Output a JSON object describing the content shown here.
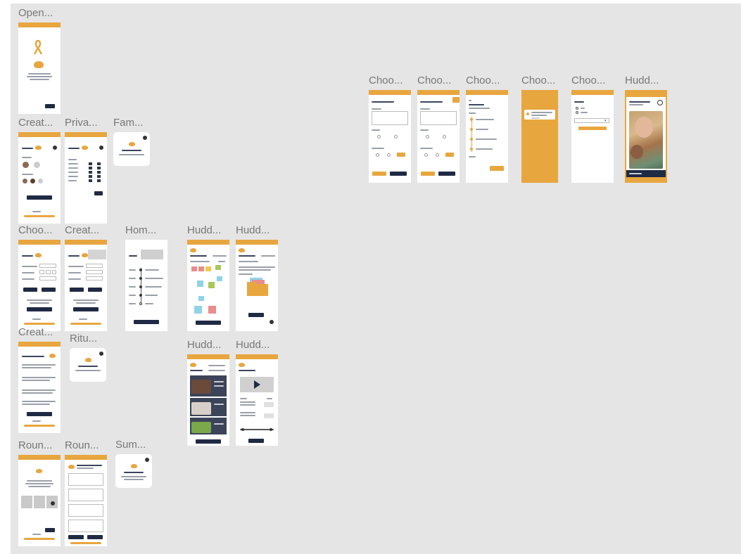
{
  "colors": {
    "canvas": "#e5e5e5",
    "accent": "#e8a63f",
    "navy": "#1f2a44"
  },
  "frames": {
    "open": "Open...",
    "creat1": "Creat...",
    "priva": "Priva...",
    "fam": "Fam...",
    "choo1": "Choo...",
    "creat2": "Creat...",
    "hom": "Hom...",
    "hudd1": "Hudd...",
    "hudd2": "Hudd...",
    "creat3": "Creat...",
    "ritu": "Ritu...",
    "hudd3": "Hudd...",
    "hudd4": "Hudd...",
    "roun1": "Roun...",
    "roun2": "Roun...",
    "sum": "Sum...",
    "choo2": "Choo...",
    "choo3": "Choo...",
    "choo4": "Choo...",
    "choo5": "Choo...",
    "choo6": "Choo...",
    "hudd5": "Hudd..."
  },
  "icons": [
    "ribbon-icon",
    "logo-icon",
    "close-icon",
    "play-icon",
    "timer-icon",
    "chevron-down-icon"
  ]
}
